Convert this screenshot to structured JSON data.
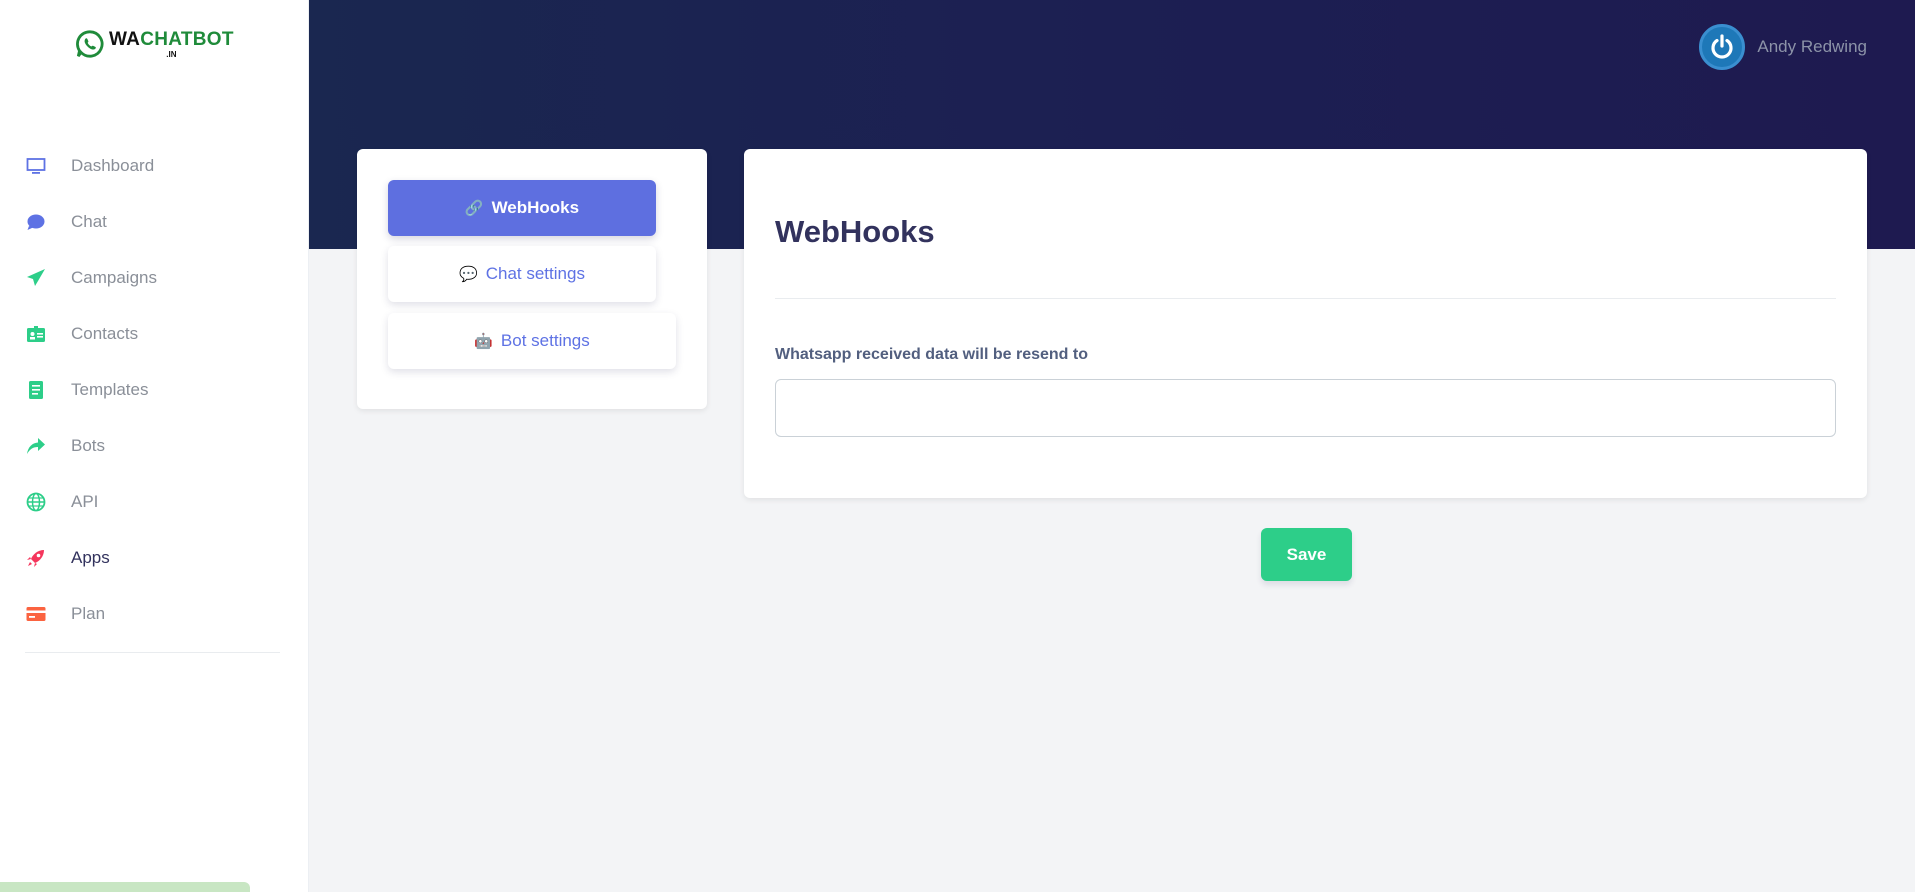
{
  "logo": {
    "brand_prefix": "WA",
    "brand_suffix": "CHATBOT",
    "domain": ".IN"
  },
  "sidebar": {
    "items": [
      {
        "label": "Dashboard",
        "icon": "monitor-icon",
        "color": "#5e72e4"
      },
      {
        "label": "Chat",
        "icon": "chat-bubble-icon",
        "color": "#5e72e4"
      },
      {
        "label": "Campaigns",
        "icon": "paper-plane-icon",
        "color": "#2dce89"
      },
      {
        "label": "Contacts",
        "icon": "contact-card-icon",
        "color": "#2dce89"
      },
      {
        "label": "Templates",
        "icon": "document-icon",
        "color": "#2dce89"
      },
      {
        "label": "Bots",
        "icon": "share-arrow-icon",
        "color": "#2dce89"
      },
      {
        "label": "API",
        "icon": "globe-icon",
        "color": "#2dce89"
      },
      {
        "label": "Apps",
        "icon": "rocket-icon",
        "color": "#f5365c"
      },
      {
        "label": "Plan",
        "icon": "credit-card-icon",
        "color": "#fb6340"
      }
    ],
    "active_index": 7
  },
  "header": {
    "user_name": "Andy Redwing"
  },
  "settings_tabs": [
    {
      "label": "WebHooks",
      "icon": "link-icon",
      "glyph": "🔗"
    },
    {
      "label": "Chat settings",
      "icon": "speech-bubble-icon",
      "glyph": "💬"
    },
    {
      "label": "Bot settings",
      "icon": "robot-icon",
      "glyph": "🤖"
    }
  ],
  "main": {
    "title": "WebHooks",
    "field_label": "Whatsapp received data will be resend to",
    "field_value": "",
    "field_placeholder": ""
  },
  "actions": {
    "save_label": "Save"
  },
  "colors": {
    "primary": "#5e6fe0",
    "success": "#2dce89",
    "header_dark": "#1c1f52"
  }
}
